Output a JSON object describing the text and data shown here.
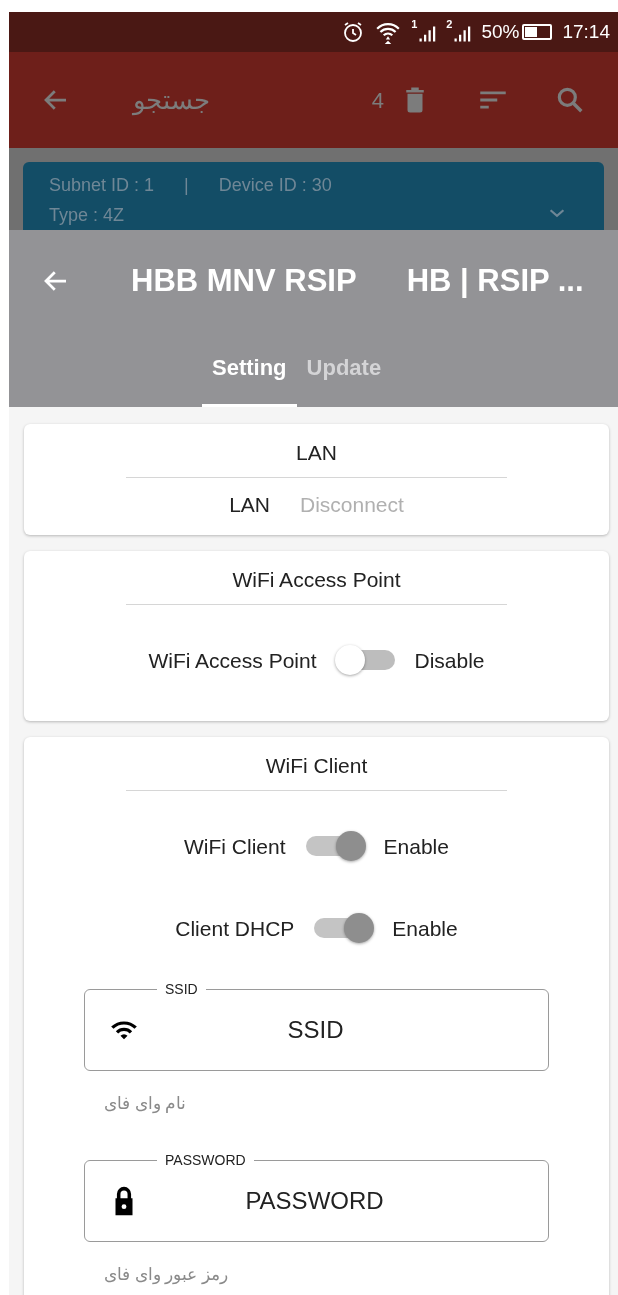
{
  "status_bar": {
    "sim_1": "1",
    "sim_2": "2",
    "battery": "50%",
    "time": "17:14"
  },
  "background_screen": {
    "search_title": "جستجو",
    "count": "4",
    "device_card": {
      "subnet": "Subnet ID : 1",
      "separator": "|",
      "device": "Device ID : 30",
      "type": "Type : 4Z"
    }
  },
  "sheet": {
    "title": "HBB MNV RSIP",
    "subtitle": "HB | RSIP ...",
    "tabs": [
      {
        "label": "Setting",
        "selected": true
      },
      {
        "label": "Update",
        "selected": false
      }
    ]
  },
  "sections": [
    {
      "title": "LAN",
      "rows": [
        {
          "kind": "status",
          "label": "LAN",
          "value": "Disconnect"
        }
      ]
    },
    {
      "title": "WiFi Access Point",
      "rows": [
        {
          "kind": "switch",
          "label": "WiFi Access Point",
          "on": false,
          "state_text": "Disable"
        }
      ]
    },
    {
      "title": "WiFi Client",
      "rows": [
        {
          "kind": "switch",
          "label": "WiFi Client",
          "on": true,
          "state_text": "Enable"
        },
        {
          "kind": "switch",
          "label": "Client DHCP",
          "on": true,
          "state_text": "Enable"
        },
        {
          "kind": "field",
          "label": "SSID",
          "value": "SSID",
          "helper": "نام وای فای"
        },
        {
          "kind": "field",
          "label": "PASSWORD",
          "value": "PASSWORD",
          "helper": "رمز عبور وای فای"
        }
      ]
    }
  ]
}
